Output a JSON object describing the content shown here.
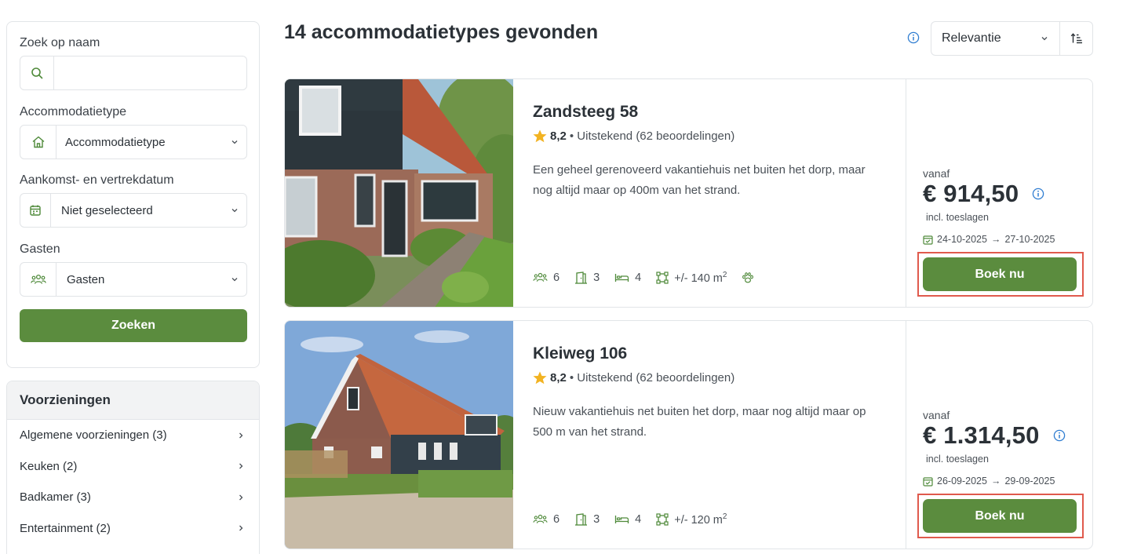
{
  "filters": {
    "search_label": "Zoek op naam",
    "search_value": "",
    "search_placeholder": "",
    "type_label": "Accommodatietype",
    "type_value": "Accommodatietype",
    "date_label": "Aankomst- en vertrekdatum",
    "date_value": "Niet geselecteerd",
    "guests_label": "Gasten",
    "guests_value": "Gasten",
    "search_button": "Zoeken"
  },
  "amenities": {
    "title": "Voorzieningen",
    "items": [
      {
        "label": "Algemene voorzieningen (3)"
      },
      {
        "label": "Keuken (2)"
      },
      {
        "label": "Badkamer (3)"
      },
      {
        "label": "Entertainment (2)"
      }
    ]
  },
  "results": {
    "title": "14 accommodatietypes gevonden",
    "sort_value": "Relevantie"
  },
  "listings": [
    {
      "name": "Zandsteeg 58",
      "rating": "8,2",
      "rating_text": "• Uitstekend (62 beoordelingen)",
      "description": "Een geheel gerenoveerd vakantiehuis net buiten het dorp, maar nog altijd maar op 400m van het strand.",
      "guests": "6",
      "bedrooms": "3",
      "beds": "4",
      "area": "+/- 140 m",
      "area_unit_sup": "2",
      "pets_allowed": true,
      "from_label": "vanaf",
      "price": "€ 914,50",
      "price_note": "incl. toeslagen",
      "date_from": "24-10-2025",
      "date_arrow": "→",
      "date_to": "27-10-2025",
      "book_label": "Boek nu"
    },
    {
      "name": "Kleiweg 106",
      "rating": "8,2",
      "rating_text": "• Uitstekend (62 beoordelingen)",
      "description": "Nieuw vakantiehuis net buiten het dorp, maar nog altijd maar op 500 m van het strand.",
      "guests": "6",
      "bedrooms": "3",
      "beds": "4",
      "area": "+/- 120 m",
      "area_unit_sup": "2",
      "pets_allowed": false,
      "from_label": "vanaf",
      "price": "€ 1.314,50",
      "price_note": "incl. toeslagen",
      "date_from": "26-09-2025",
      "date_arrow": "→",
      "date_to": "29-09-2025",
      "book_label": "Boek nu"
    }
  ],
  "colors": {
    "brand_green": "#5b8c3e",
    "icon_green": "#4f8a3a",
    "info_blue": "#2f7dd1",
    "star_gold": "#f2b322",
    "highlight_red": "#e05a4d"
  }
}
